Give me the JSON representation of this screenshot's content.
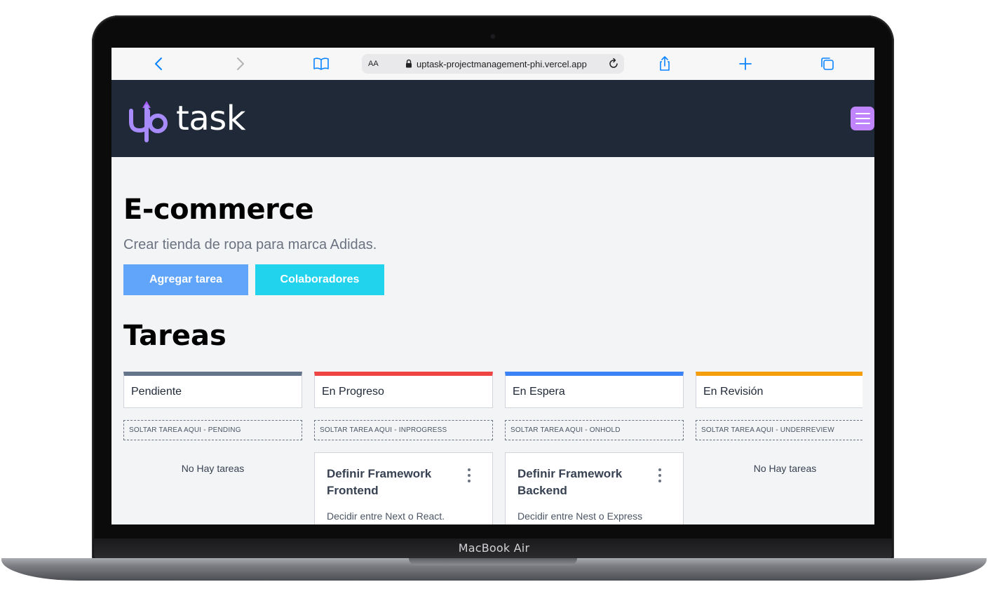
{
  "device": {
    "label": "MacBook Air"
  },
  "browser": {
    "aa_label": "AA",
    "url": "uptask-projectmanagement-phi.vercel.app",
    "icons": [
      "back-icon",
      "forward-icon",
      "book-icon",
      "lock-icon",
      "reload-icon",
      "share-icon",
      "plus-icon",
      "tabs-icon"
    ]
  },
  "app": {
    "logo_text": "task",
    "brand_color": "#c084fc",
    "header_color": "#1f2937"
  },
  "project": {
    "name": "E-commerce",
    "description": "Crear tienda de ropa para marca Adidas.",
    "add_task_label": "Agregar tarea",
    "collaborators_label": "Colaboradores"
  },
  "tasks": {
    "heading": "Tareas",
    "columns": [
      {
        "title": "Pendiente",
        "color": "#64748b",
        "drop_label": "SOLTAR TAREA AQUI - PENDING",
        "empty_label": "No Hay tareas"
      },
      {
        "title": "En Progreso",
        "color": "#ef4444",
        "drop_label": "SOLTAR TAREA AQUI - INPROGRESS",
        "card": {
          "title": "Definir Framework Frontend",
          "description": "Decidir entre Next o React."
        }
      },
      {
        "title": "En Espera",
        "color": "#3b82f6",
        "drop_label": "SOLTAR TAREA AQUI - ONHOLD",
        "card": {
          "title": "Definir Framework Backend",
          "description": "Decidir entre Nest o Express"
        }
      },
      {
        "title": "En Revisión",
        "color": "#f59e0b",
        "drop_label": "SOLTAR TAREA AQUI - UNDERREVIEW",
        "empty_label": "No Hay tareas"
      }
    ]
  }
}
